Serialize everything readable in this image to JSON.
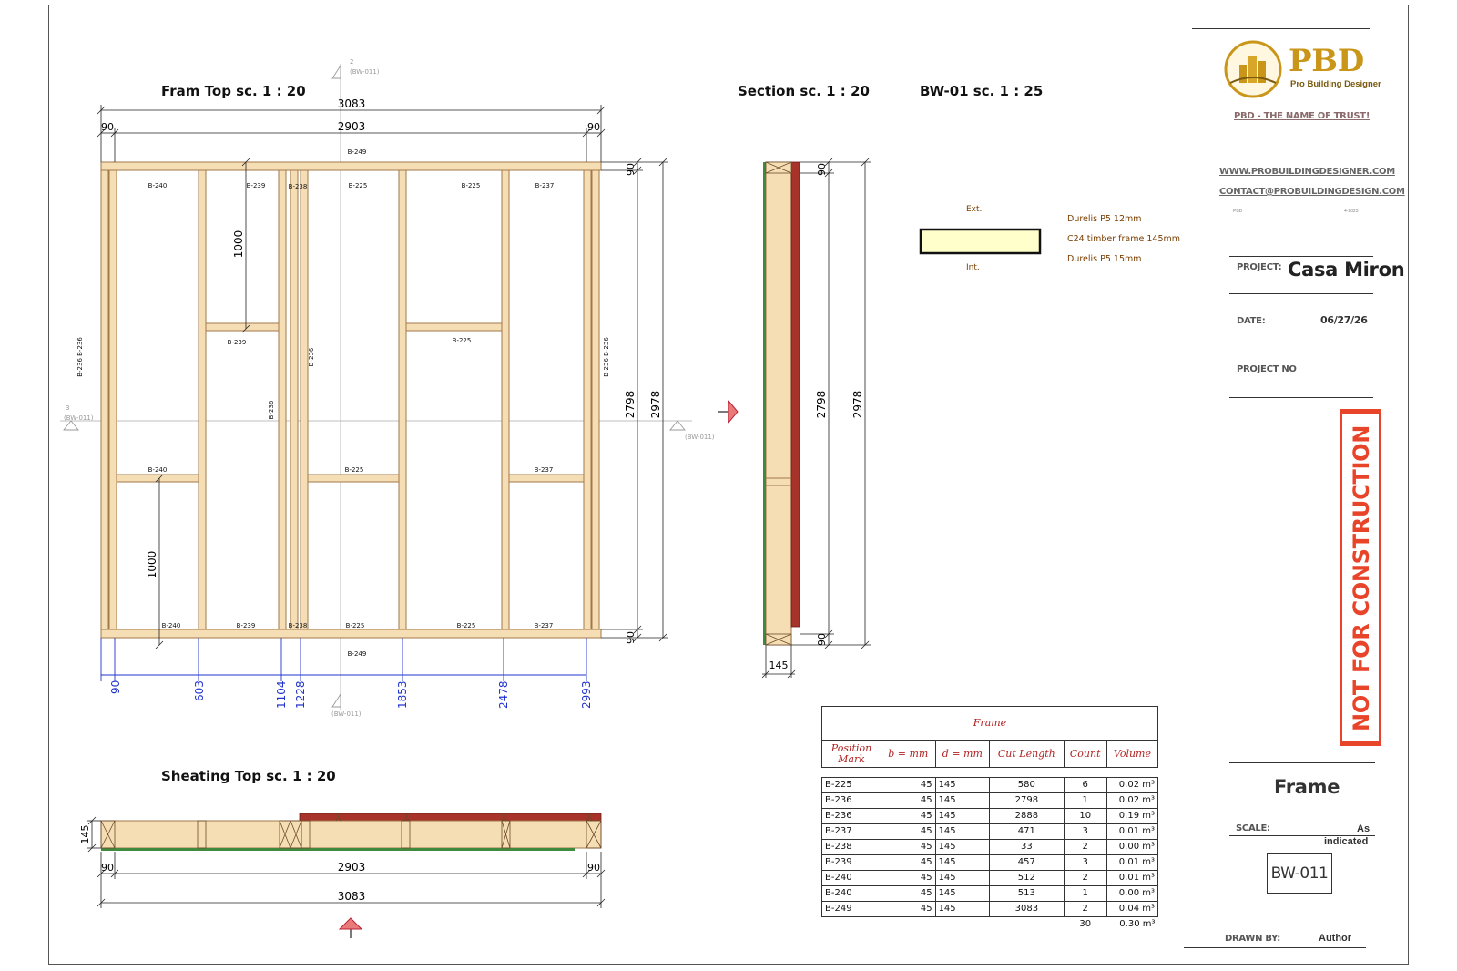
{
  "views": {
    "frame_top": "Fram Top sc. 1 : 20",
    "section": "Section sc. 1 : 20",
    "bw01": "BW-01 sc. 1 : 25",
    "sheating_top": "Sheating Top sc. 1 : 20"
  },
  "frame_dims": {
    "overall": "3083",
    "inner": "2903",
    "left_end": "90",
    "right_end": "90",
    "stud_positions": [
      "90",
      "603",
      "1104",
      "1228",
      "1853",
      "2478",
      "2993"
    ],
    "height_inner": "2798",
    "height_overall": "2978",
    "plate_top": "90",
    "plate_bottom": "90",
    "nogging_1": "1000",
    "nogging_2": "1000"
  },
  "frame_marks": {
    "top_plate": "B-249",
    "bottom_plate": "B-249",
    "b240": "B-240",
    "b239": "B-239",
    "b238": "B-238",
    "b225": "B-225",
    "b237": "B-237",
    "b236": "B-236",
    "b236_pair": "B-236 B-236"
  },
  "section_refs": {
    "num_2": "2",
    "num_3": "3",
    "ref": "(BW-011)"
  },
  "section_view": {
    "width": "145",
    "plate_top": "90",
    "plate_bottom": "90",
    "height_inner": "2798",
    "height_overall": "2978"
  },
  "bw01": {
    "ext": "Ext.",
    "int": "Int.",
    "layers": [
      "Durelis P5 12mm",
      "C24 timber frame 145mm",
      "Durelis P5 15mm"
    ],
    "fill_color": "#ffffcc"
  },
  "sheating": {
    "thickness": "145",
    "left": "90",
    "right": "90",
    "inner": "2903",
    "overall": "3083"
  },
  "schedule": {
    "title": "Frame",
    "headers": [
      "Position Mark",
      "b = mm",
      "d = mm",
      "Cut Length",
      "Count",
      "Volume"
    ],
    "rows": [
      [
        "B-225",
        "45",
        "145",
        "580",
        "6",
        "0.02 m³"
      ],
      [
        "B-236",
        "45",
        "145",
        "2798",
        "1",
        "0.02 m³"
      ],
      [
        "B-236",
        "45",
        "145",
        "2888",
        "10",
        "0.19 m³"
      ],
      [
        "B-237",
        "45",
        "145",
        "471",
        "3",
        "0.01 m³"
      ],
      [
        "B-238",
        "45",
        "145",
        "33",
        "2",
        "0.00 m³"
      ],
      [
        "B-239",
        "45",
        "145",
        "457",
        "3",
        "0.01 m³"
      ],
      [
        "B-240",
        "45",
        "145",
        "512",
        "2",
        "0.01 m³"
      ],
      [
        "B-240",
        "45",
        "145",
        "513",
        "1",
        "0.00 m³"
      ],
      [
        "B-249",
        "45",
        "145",
        "3083",
        "2",
        "0.04 m³"
      ]
    ],
    "total_count": "30",
    "total_volume": "0.30 m³"
  },
  "title_block": {
    "logo_text": "PBD",
    "logo_sub": "Pro Building Designer",
    "tagline": "PBD - THE NAME OF TRUST!",
    "website": "WWW.PROBUILDINGDESIGNER.COM",
    "email": "CONTACT@PROBUILDINGDESIGN.COM",
    "small_left": "PBD",
    "small_right": "4-2023",
    "project_label": "PROJECT:",
    "project_name": "Casa Miron",
    "date_label": "DATE:",
    "date_value": "06/27/26",
    "project_no_label": "PROJECT NO",
    "stamp": "NOT FOR CONSTRUCTION",
    "sheet_name": "Frame",
    "scale_label": "SCALE:",
    "scale_value_1": "As",
    "scale_value_2": "indicated",
    "sheet_number": "BW-011",
    "drawn_by_label": "DRAWN BY:",
    "drawn_by_value": "Author"
  },
  "colors": {
    "timber": "#f6deb4",
    "timber_edge": "#a0784a",
    "osb_red": "#a8332b",
    "dim_blue": "#2233cc",
    "stamp_red": "#e8442a",
    "logo_gold": "#c9961a"
  }
}
